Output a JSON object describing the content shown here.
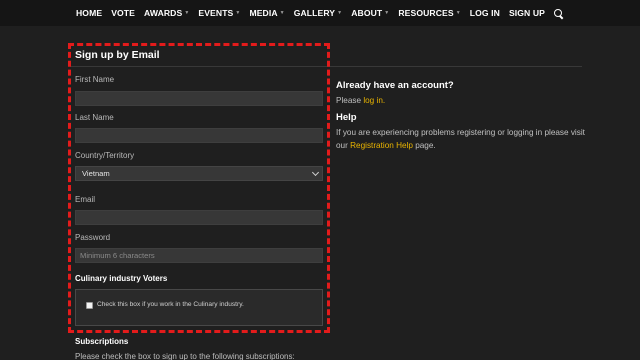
{
  "nav": {
    "items": [
      {
        "label": "HOME",
        "dropdown": false
      },
      {
        "label": "VOTE",
        "dropdown": false
      },
      {
        "label": "AWARDS",
        "dropdown": true
      },
      {
        "label": "EVENTS",
        "dropdown": true
      },
      {
        "label": "MEDIA",
        "dropdown": true
      },
      {
        "label": "GALLERY",
        "dropdown": true
      },
      {
        "label": "ABOUT",
        "dropdown": true
      },
      {
        "label": "RESOURCES",
        "dropdown": true
      },
      {
        "label": "LOG IN",
        "dropdown": false
      },
      {
        "label": "SIGN UP",
        "dropdown": false
      }
    ],
    "search_icon": "search-icon"
  },
  "form": {
    "title": "Sign up by Email",
    "first_name_label": "First Name",
    "first_name_value": "",
    "last_name_label": "Last Name",
    "last_name_value": "",
    "country_label": "Country/Territory",
    "country_value": "Vietnam",
    "email_label": "Email",
    "email_value": "",
    "password_label": "Password",
    "password_placeholder": "Minimum 6 characters",
    "voters_heading": "Culinary industry Voters",
    "voters_checkbox_label": "Check this box if you work in the Culinary industry.",
    "subscriptions_heading": "Subscriptions",
    "subscriptions_text": "Please check the box to sign up to the following subscriptions:"
  },
  "sidebar": {
    "account_title": "Already have an account?",
    "account_prefix": "Please ",
    "account_link": "log in.",
    "help_title": "Help",
    "help_text": "If you are experiencing problems registering or logging in please visit our ",
    "help_link": "Registration Help",
    "help_suffix": " page."
  },
  "colors": {
    "background": "#1f1f1f",
    "nav_background": "#151515",
    "highlight_border": "#e31b1b",
    "link": "#e9b400"
  }
}
